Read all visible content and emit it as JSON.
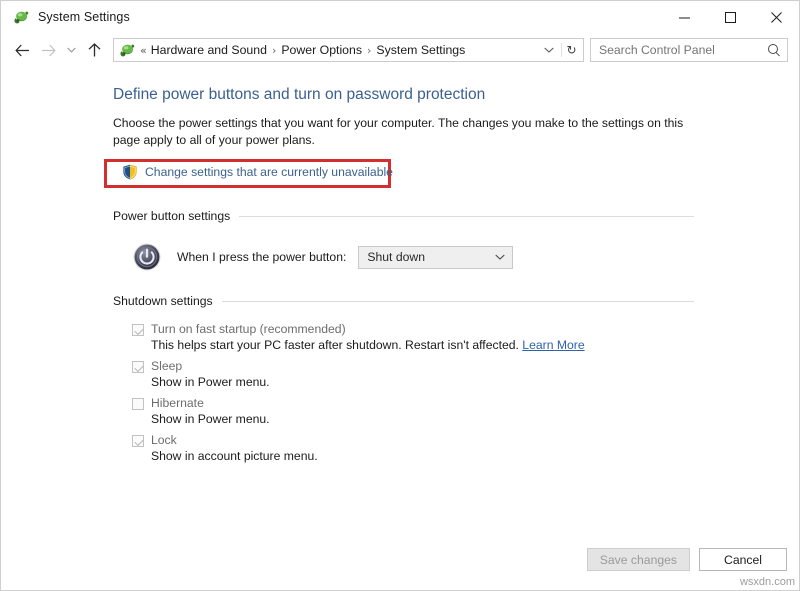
{
  "window": {
    "title": "System Settings",
    "title_icon": "power-options-icon",
    "minimize_label": "—",
    "maximize_label": "☐",
    "close_label": "✕"
  },
  "navbar": {
    "back_icon": "back-arrow-icon",
    "back_label": "←",
    "forward_icon": "forward-arrow-icon",
    "forward_label": "→",
    "recent_icon": "recent-pages-chevron-icon",
    "recent_label": "⌄",
    "up_icon": "up-arrow-icon",
    "up_label": "↑",
    "address_icon": "power-options-icon",
    "overflow_label": "«",
    "breadcrumbs": [
      {
        "label": "Hardware and Sound"
      },
      {
        "label": "Power Options"
      },
      {
        "label": "System Settings"
      }
    ],
    "separator": "›",
    "dropdown_icon": "chevron-down-icon",
    "dropdown_label": "⌄",
    "refresh_icon": "refresh-icon",
    "refresh_label": "↻"
  },
  "search": {
    "placeholder": "Search Control Panel",
    "value": "",
    "icon": "search-icon"
  },
  "main": {
    "heading": "Define power buttons and turn on password protection",
    "description": "Choose the power settings that you want for your computer. The changes you make to the settings on this page apply to all of your power plans.",
    "uac_link": {
      "text": "Change settings that are currently unavailable",
      "icon": "uac-shield-icon",
      "highlight_color": "#d42f2f"
    },
    "power_button_settings": {
      "title": "Power button settings",
      "row_icon": "power-button-icon",
      "row_label": "When I press the power button:",
      "dropdown_value": "Shut down",
      "dropdown_icon": "chevron-down-icon",
      "dropdown_chevron": "⌄",
      "disabled": true
    },
    "shutdown_settings": {
      "title": "Shutdown settings",
      "items": [
        {
          "label": "Turn on fast startup (recommended)",
          "checked": true,
          "description": "This helps start your PC faster after shutdown. Restart isn't affected.",
          "link": "Learn More"
        },
        {
          "label": "Sleep",
          "checked": true,
          "description": "Show in Power menu.",
          "link": ""
        },
        {
          "label": "Hibernate",
          "checked": false,
          "description": "Show in Power menu.",
          "link": ""
        },
        {
          "label": "Lock",
          "checked": true,
          "description": "Show in account picture menu.",
          "link": ""
        }
      ]
    }
  },
  "footer": {
    "save_label": "Save changes",
    "save_disabled": true,
    "cancel_label": "Cancel"
  },
  "watermark": "wsxdn.com",
  "colors": {
    "heading": "#3b5f8f",
    "link": "#3b5f8f",
    "highlight": "#d42f2f",
    "disabled_text": "#6d6d6d"
  }
}
